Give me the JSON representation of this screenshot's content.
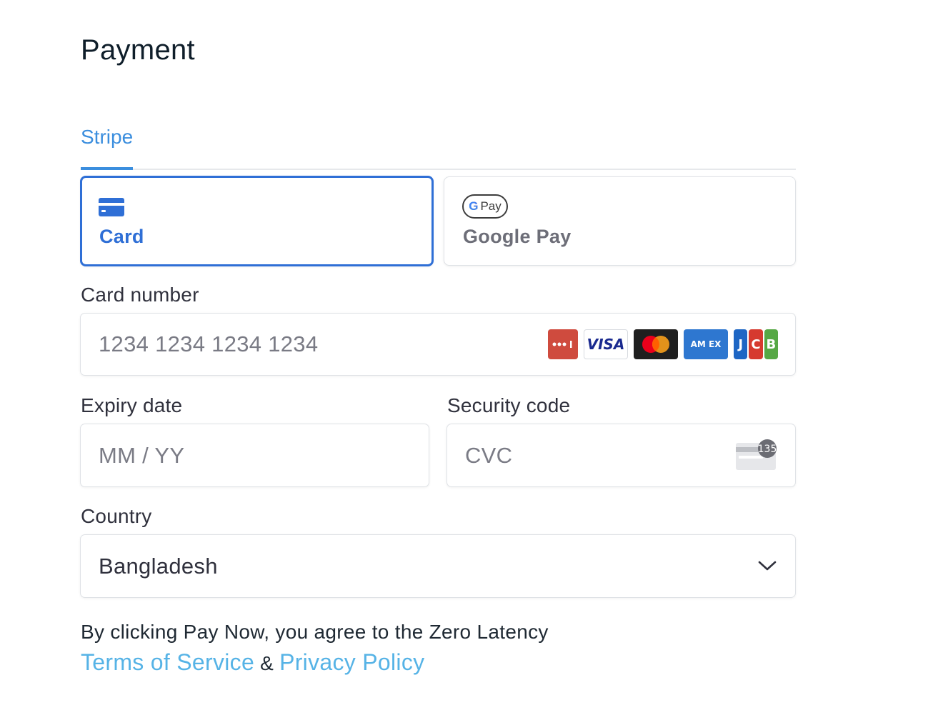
{
  "page": {
    "title": "Payment"
  },
  "tabs": [
    {
      "label": "Stripe",
      "active": true
    }
  ],
  "payment_methods": [
    {
      "label": "Card",
      "icon": "credit-card-icon",
      "selected": true
    },
    {
      "label": "Google Pay",
      "icon": "google-pay-icon",
      "selected": false
    }
  ],
  "google_pay_badge": {
    "g": "G",
    "text": "Pay"
  },
  "card_number": {
    "label": "Card number",
    "placeholder": "1234 1234 1234 1234",
    "brands": [
      "generic-card-icon",
      "visa-icon",
      "mastercard-icon",
      "amex-icon",
      "jcb-icon"
    ],
    "brand_text": {
      "visa": "VISA",
      "amex": "AM EX",
      "jcb": [
        "J",
        "C",
        "B"
      ]
    }
  },
  "expiry": {
    "label": "Expiry date",
    "placeholder": "MM / YY"
  },
  "security_code": {
    "label": "Security code",
    "placeholder": "CVC",
    "icon": "cvc-card-icon",
    "icon_badge": "135"
  },
  "country": {
    "label": "Country",
    "value": "Bangladesh",
    "icon": "chevron-down-icon"
  },
  "terms": {
    "prefix": "By clicking Pay Now, you agree to the Zero Latency",
    "terms_link": "Terms of Service",
    "separator": "&",
    "privacy_link": "Privacy Policy"
  },
  "colors": {
    "accent": "#2f6fd6",
    "tab_accent": "#3b8ede",
    "link": "#56b3e6",
    "border": "#dfe2e6",
    "placeholder": "#7a7b85"
  }
}
